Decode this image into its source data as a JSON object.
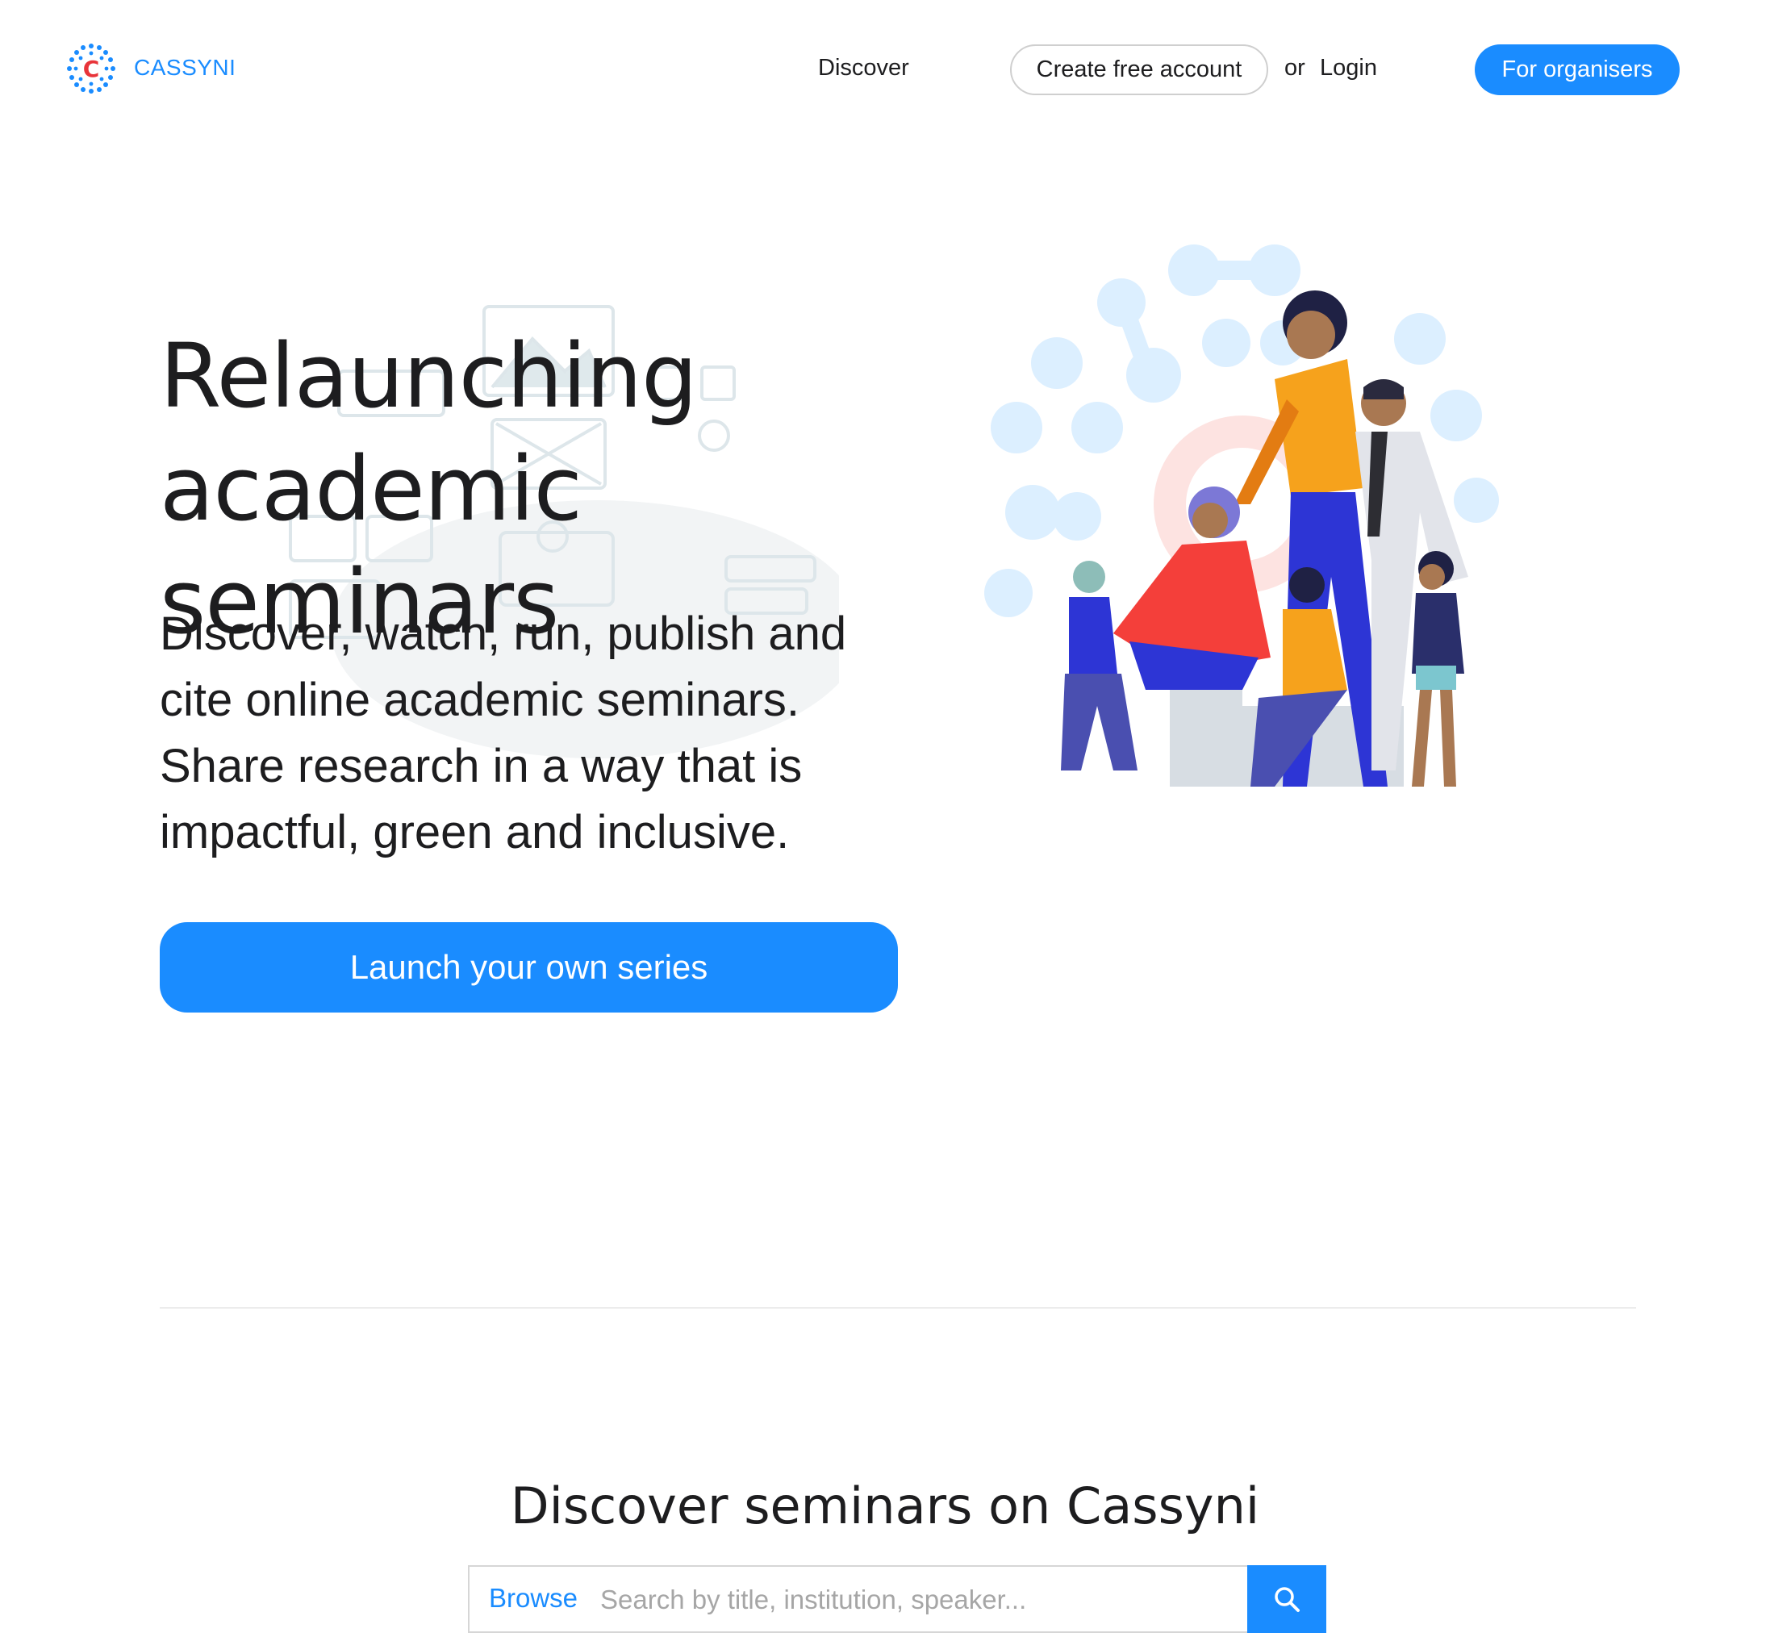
{
  "header": {
    "brand": "CASSYNI",
    "nav_discover": "Discover",
    "create_account": "Create free account",
    "or": "or",
    "login": "Login",
    "for_organisers": "For organisers"
  },
  "hero": {
    "title_line1": "Relaunching",
    "title_line2": "academic seminars",
    "subtitle_line1": "Discover, watch, run, publish and",
    "subtitle_line2": "cite online academic seminars.",
    "subtitle_line3": "Share research in a way that is",
    "subtitle_line4": "impactful, green and inclusive.",
    "cta": "Launch your own series"
  },
  "discover": {
    "title": "Discover seminars on Cassyni",
    "browse": "Browse",
    "search_placeholder": "Search by title, institution, speaker..."
  },
  "colors": {
    "accent": "#1a8cff",
    "logo_red": "#e8343a"
  },
  "icons": {
    "logo": "cassyni-logo-icon",
    "search": "search-icon"
  }
}
